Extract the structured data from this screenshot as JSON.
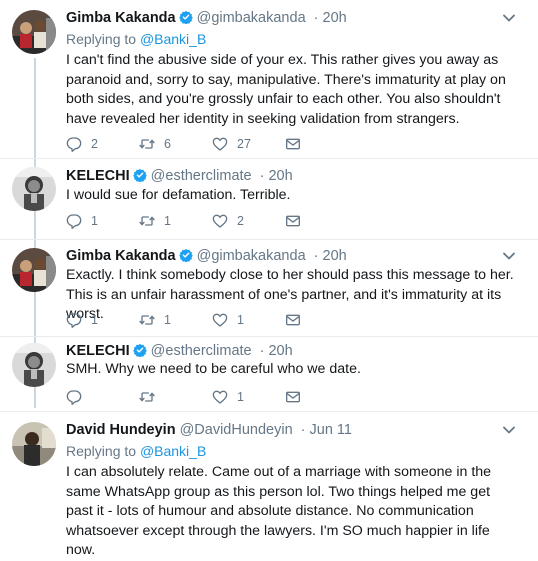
{
  "tweets": [
    {
      "name": "Gimba Kakanda",
      "handle": "@gimbakakanda",
      "time": "· 20h",
      "verified": true,
      "replying_prefix": "Replying to",
      "replying_to": "@Banki_B",
      "text": "I can't find the abusive side of your ex. This rather gives you away as paranoid and, sorry to say, manipulative. There's immaturity at play on both sides, and you're grossly unfair to each other. You also shouldn't have revealed her identity in seeking validation from strangers.",
      "replies": "2",
      "retweets": "6",
      "likes": "27"
    },
    {
      "name": "KELECHI",
      "handle": "@estherclimate",
      "time": "· 20h",
      "verified": true,
      "text": "I would sue for defamation. Terrible.",
      "replies": "1",
      "retweets": "1",
      "likes": "2"
    },
    {
      "name": "Gimba Kakanda",
      "handle": "@gimbakakanda",
      "time": "· 20h",
      "verified": true,
      "text": "Exactly. I think somebody close to her should pass this message to her. This is an unfair harassment of one's partner, and it's immaturity at its worst.",
      "replies": "1",
      "retweets": "1",
      "likes": "1"
    },
    {
      "name": "KELECHI",
      "handle": "@estherclimate",
      "time": "· 20h",
      "verified": true,
      "text": "SMH. Why we need to be careful who we date.",
      "replies": "",
      "retweets": "",
      "likes": "1"
    },
    {
      "name": "David Hundeyin",
      "handle": "@DavidHundeyin",
      "time": "· Jun 11",
      "verified": false,
      "replying_prefix": "Replying to",
      "replying_to": "@Banki_B",
      "text": "I can absolutely relate. Came out of a marriage with someone in the same WhatsApp group as this person lol. Two things helped me get past it - lots of humour and absolute distance. No communication whatsoever except through the lawyers. I'm SO much happier in life now."
    }
  ],
  "icons": {
    "reply": "reply-icon",
    "retweet": "retweet-icon",
    "like": "heart-icon",
    "dm": "envelope-icon",
    "more": "chevron-down-icon",
    "verified": "verified-badge-icon"
  },
  "colors": {
    "text": "#14171a",
    "secondary": "#657786",
    "link": "#1b95e0",
    "verified": "#1da1f2",
    "thread_line": "#ccd6dd",
    "separator": "#e6ecf0"
  }
}
